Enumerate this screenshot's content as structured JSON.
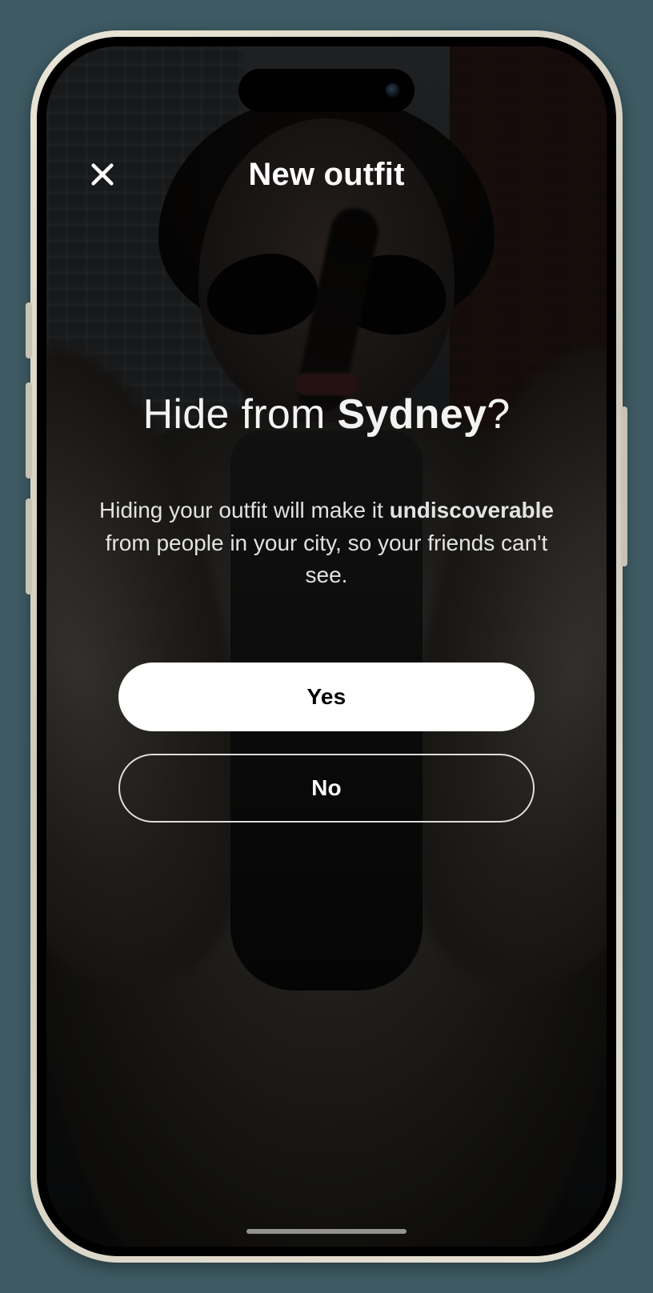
{
  "nav": {
    "title": "New outfit",
    "close_icon": "close-icon"
  },
  "modal": {
    "heading_prefix": "Hide from ",
    "heading_city": "Sydney",
    "heading_suffix": "?",
    "sub_a": "Hiding your outfit will make it ",
    "sub_bold": "undiscoverable",
    "sub_b": " from people in your city, so your friends can't see."
  },
  "buttons": {
    "yes": "Yes",
    "no": "No"
  },
  "colors": {
    "page_bg": "#3e5a63",
    "text": "#ffffff",
    "primary_bg": "#ffffff",
    "primary_fg": "#000000"
  }
}
